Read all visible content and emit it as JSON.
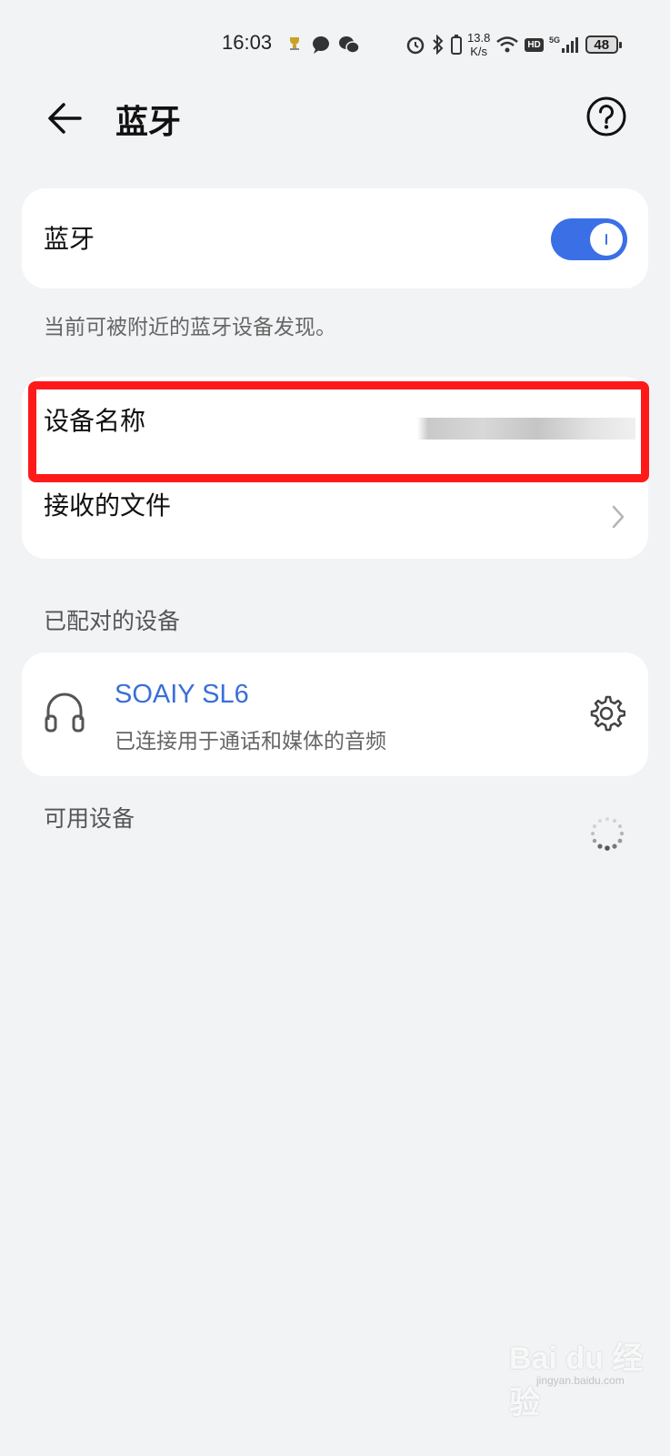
{
  "status_bar": {
    "time": "16:03",
    "net_speed_value": "13.8",
    "net_speed_unit": "K/s",
    "hd": "HD",
    "network": "5G",
    "battery": "48"
  },
  "app_bar": {
    "title": "蓝牙"
  },
  "bluetooth": {
    "label": "蓝牙",
    "enabled": true,
    "hint": "当前可被附近的蓝牙设备发现。"
  },
  "device_card": {
    "name_label": "设备名称",
    "received_files_label": "接收的文件"
  },
  "paired": {
    "section_title": "已配对的设备",
    "devices": [
      {
        "name": "SOAIY SL6",
        "status": "已连接用于通话和媒体的音频"
      }
    ]
  },
  "available": {
    "section_title": "可用设备"
  },
  "watermark": {
    "brand": "Bai du 经验",
    "url": "jingyan.baidu.com"
  },
  "colors": {
    "accent": "#3a6fe6",
    "highlight": "#ff1a1a",
    "background": "#f1f3f5"
  }
}
